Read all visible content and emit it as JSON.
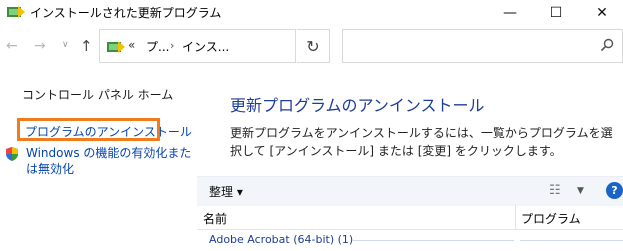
{
  "window": {
    "title": "インストールされた更新プログラム",
    "minimize": "—",
    "maximize": "☐",
    "close": "✕"
  },
  "nav": {
    "back": "←",
    "forward": "→",
    "recent": "∨",
    "up": "↑",
    "refresh": "↻"
  },
  "address": {
    "overflow": "«",
    "crumbs": [
      "プ...",
      "インス..."
    ],
    "separator": "›"
  },
  "search": {
    "placeholder": "",
    "icon": "search-icon"
  },
  "sidebar": {
    "home": "コントロール パネル ホーム",
    "uninstall_program": "プログラムのアンインストール",
    "windows_features": "Windows の機能の有効化または無効化"
  },
  "main": {
    "heading": "更新プログラムのアンインストール",
    "description": "更新プログラムをアンインストールするには、一覧からプログラムを選択して [アンインストール] または [変更] をクリックします。"
  },
  "toolbar": {
    "organize": "整理 ▾",
    "view_options": "☷",
    "view_dropdown": "▼",
    "help": "?"
  },
  "table": {
    "columns": [
      "名前",
      "プログラム"
    ],
    "groups": [
      "Adobe Acrobat (64-bit) (1)"
    ]
  },
  "colors": {
    "highlight_border": "#f07c1d",
    "link": "#0645ad",
    "heading": "#1e3d99",
    "toolbar_bg": "#f2f6fb",
    "help_bg": "#1a64c8"
  }
}
